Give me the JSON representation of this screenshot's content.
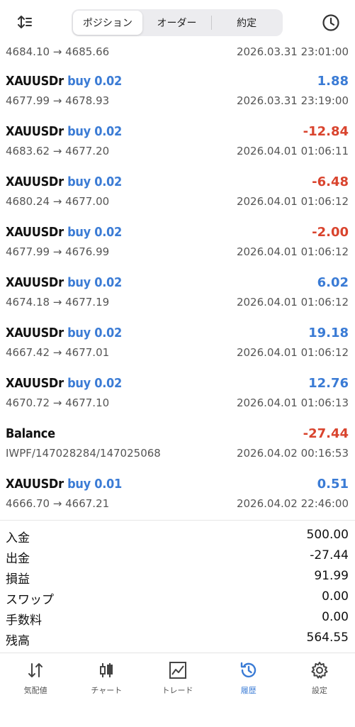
{
  "header": {
    "tabs": [
      {
        "label": "ポジション",
        "active": true
      },
      {
        "label": "オーダー",
        "active": false
      },
      {
        "label": "約定",
        "active": false
      }
    ],
    "left_icon": "sort-icon",
    "right_icon": "history-clock-icon"
  },
  "first_partial": {
    "prices": "4684.10 → 4685.66",
    "time": "2026.03.31 23:01:00"
  },
  "records": [
    {
      "symbol": "XAUUSDr",
      "side": "buy 0.02",
      "profit": "1.88",
      "sign": "pos",
      "prices": "4677.99 → 4678.93",
      "time": "2026.03.31 23:19:00"
    },
    {
      "symbol": "XAUUSDr",
      "side": "buy 0.02",
      "profit": "-12.84",
      "sign": "neg",
      "prices": "4683.62 → 4677.20",
      "time": "2026.04.01 01:06:11"
    },
    {
      "symbol": "XAUUSDr",
      "side": "buy 0.02",
      "profit": "-6.48",
      "sign": "neg",
      "prices": "4680.24 → 4677.00",
      "time": "2026.04.01 01:06:12"
    },
    {
      "symbol": "XAUUSDr",
      "side": "buy 0.02",
      "profit": "-2.00",
      "sign": "neg",
      "prices": "4677.99 → 4676.99",
      "time": "2026.04.01 01:06:12"
    },
    {
      "symbol": "XAUUSDr",
      "side": "buy 0.02",
      "profit": "6.02",
      "sign": "pos",
      "prices": "4674.18 → 4677.19",
      "time": "2026.04.01 01:06:12"
    },
    {
      "symbol": "XAUUSDr",
      "side": "buy 0.02",
      "profit": "19.18",
      "sign": "pos",
      "prices": "4667.42 → 4677.01",
      "time": "2026.04.01 01:06:12"
    },
    {
      "symbol": "XAUUSDr",
      "side": "buy 0.02",
      "profit": "12.76",
      "sign": "pos",
      "prices": "4670.72 → 4677.10",
      "time": "2026.04.01 01:06:13"
    },
    {
      "symbol": "Balance",
      "side": "",
      "profit": "-27.44",
      "sign": "neg",
      "prices": "IWPF/147028284/147025068",
      "time": "2026.04.02 00:16:53"
    },
    {
      "symbol": "XAUUSDr",
      "side": "buy 0.01",
      "profit": "0.51",
      "sign": "pos",
      "prices": "4666.70 → 4667.21",
      "time": "2026.04.02 22:46:00"
    }
  ],
  "summary": [
    {
      "label": "入金",
      "value": "500.00"
    },
    {
      "label": "出金",
      "value": "-27.44"
    },
    {
      "label": "損益",
      "value": "91.99"
    },
    {
      "label": "スワップ",
      "value": "0.00"
    },
    {
      "label": "手数料",
      "value": "0.00"
    },
    {
      "label": "残高",
      "value": "564.55"
    }
  ],
  "nav": [
    {
      "label": "気配値",
      "icon": "quotes-arrows-icon",
      "active": false
    },
    {
      "label": "チャート",
      "icon": "candlestick-chart-icon",
      "active": false
    },
    {
      "label": "トレード",
      "icon": "trade-line-chart-icon",
      "active": false
    },
    {
      "label": "履歴",
      "icon": "history-icon",
      "active": true
    },
    {
      "label": "設定",
      "icon": "settings-gear-icon",
      "active": false
    }
  ],
  "colors": {
    "accent": "#3a7bd5",
    "negative": "#d9442e"
  }
}
